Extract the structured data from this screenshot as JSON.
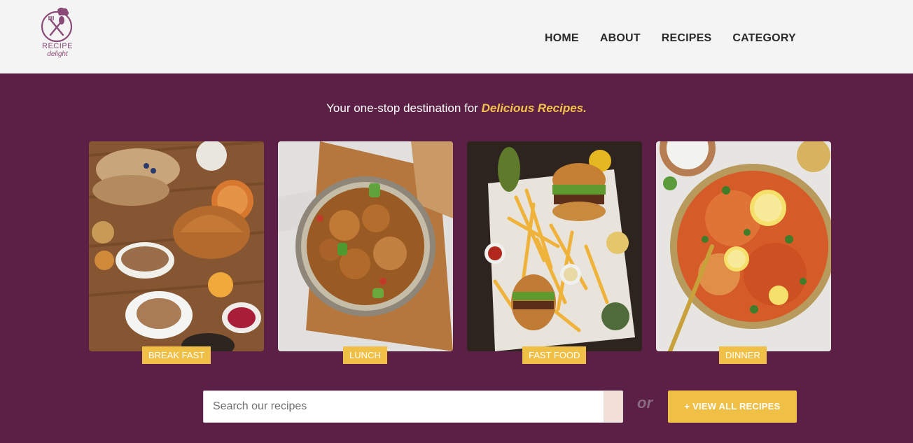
{
  "brand": {
    "line1": "RECIPE",
    "line2": "delight",
    "color": "#8a4a78"
  },
  "nav": {
    "items": [
      {
        "label": "HOME"
      },
      {
        "label": "ABOUT"
      },
      {
        "label": "RECIPES"
      },
      {
        "label": "CATEGORY"
      }
    ]
  },
  "hero": {
    "tagline_prefix": "Your one-stop destination for ",
    "tagline_accent": "Delicious Recipes.",
    "accent_color": "#f3c24d",
    "background": "#5c1f45"
  },
  "categories": [
    {
      "label": "BREAK FAST",
      "image": "breakfast-spread-photo"
    },
    {
      "label": "LUNCH",
      "image": "curry-pot-photo"
    },
    {
      "label": "FAST FOOD",
      "image": "burger-fries-photo"
    },
    {
      "label": "DINNER",
      "image": "biryani-photo"
    }
  ],
  "search": {
    "placeholder": "Search our recipes",
    "value": ""
  },
  "or_text": "or",
  "view_all_label": "+ VIEW ALL RECIPES"
}
